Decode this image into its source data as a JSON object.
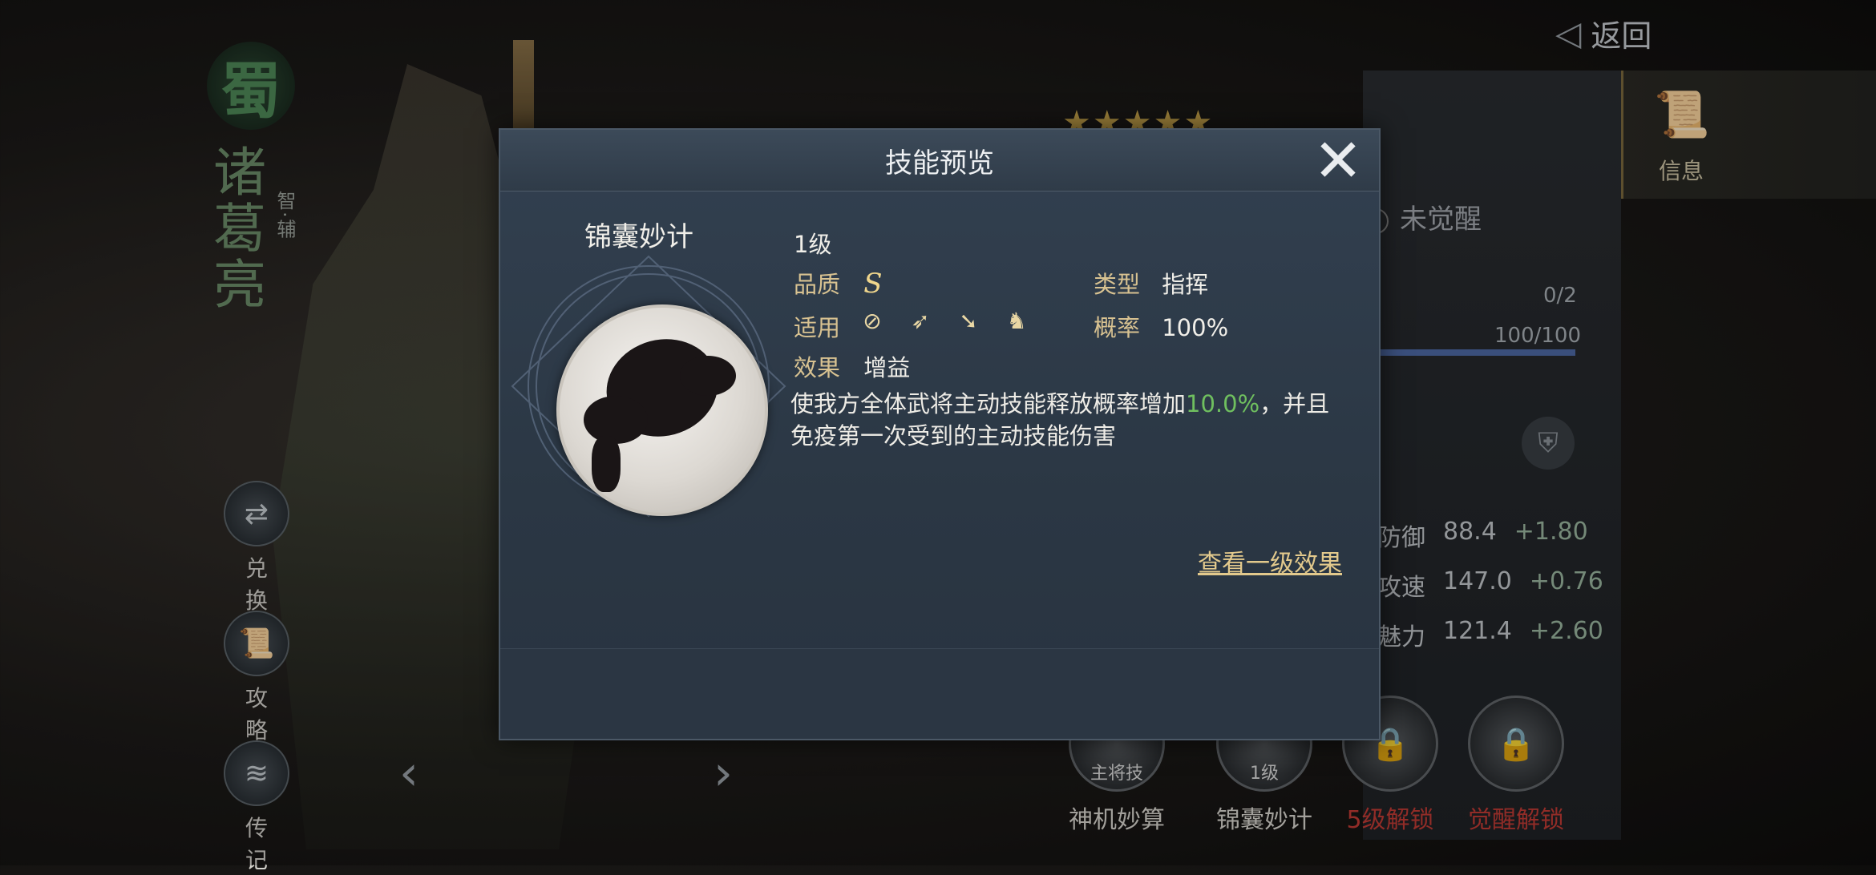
{
  "background": {
    "faction": "蜀",
    "hero_name": "诸葛亮",
    "hero_role": "智·辅",
    "side_buttons": [
      {
        "label": "兑换",
        "icon": "exchange-icon"
      },
      {
        "label": "攻略",
        "icon": "guide-scroll-icon"
      },
      {
        "label": "传记",
        "icon": "biography-icon"
      }
    ],
    "back_label": "返回",
    "info_tab_label": "信息",
    "stars": "★★★★★",
    "awaken_status": "未觉醒",
    "progress_a": "0/2",
    "progress_b": "100/100",
    "progress_b_fraction": 1.0,
    "attributes": [
      {
        "name": "防御",
        "value": "88.4",
        "plus": "+1.80"
      },
      {
        "name": "攻速",
        "value": "147.0",
        "plus": "+0.76"
      },
      {
        "name": "魅力",
        "value": "121.4",
        "plus": "+2.60"
      }
    ],
    "skills": [
      {
        "name": "神机妙算",
        "badge": "主将技",
        "locked": false
      },
      {
        "name": "锦囊妙计",
        "badge": "1级",
        "locked": false
      },
      {
        "name": "5级解锁",
        "badge": "",
        "locked": true
      },
      {
        "name": "觉醒解锁",
        "badge": "",
        "locked": true
      }
    ]
  },
  "modal": {
    "title": "技能预览",
    "skill_name": "锦囊妙计",
    "level": "1级",
    "quality_label": "品质",
    "quality_value": "S",
    "type_label": "类型",
    "type_value": "指挥",
    "apply_label": "适用",
    "apply_icons": [
      "shield-unit-icon",
      "bow-unit-icon",
      "spear-unit-icon",
      "cavalry-unit-icon"
    ],
    "chance_label": "概率",
    "chance_value": "100%",
    "effect_label": "效果",
    "effect_value": "增益",
    "description_pre": "使我方全体武将主动技能释放概率增加",
    "description_highlight": "10.0%",
    "description_post": "，并且免疫第一次受到的主动技能伤害",
    "view_link": "查看一级效果",
    "highlight_color": "#6fbf5f"
  }
}
